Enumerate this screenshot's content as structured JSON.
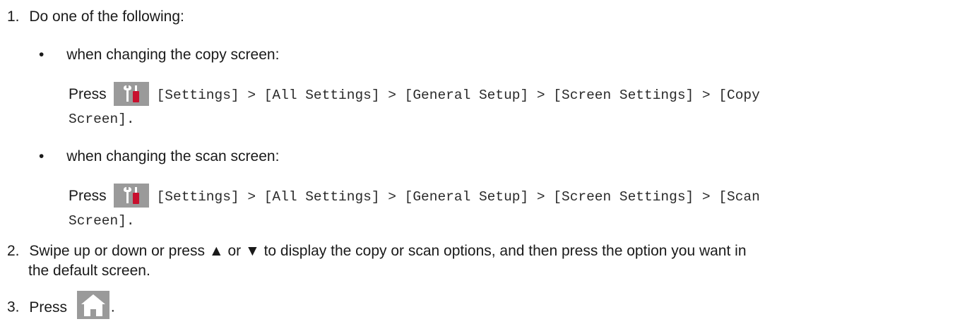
{
  "step1": {
    "number": "1.",
    "text": "Do one of the following:",
    "options": [
      {
        "bullet": "•",
        "text": "when changing the copy screen:",
        "press": "Press",
        "path": "[Settings] > [All Settings] > [General Setup] > [Screen Settings] > [Copy",
        "path_cont": "Screen]."
      },
      {
        "bullet": "•",
        "text": "when changing the scan screen:",
        "press": "Press",
        "path": "[Settings] > [All Settings] > [General Setup] > [Screen Settings] > [Scan",
        "path_cont": "Screen]."
      }
    ]
  },
  "step2": {
    "number": "2.",
    "line1": "Swipe up or down or press ▲ or ▼ to display the copy or scan options, and then press the option you want in",
    "line2": "the default screen."
  },
  "step3": {
    "number": "3.",
    "press": "Press",
    "suffix": "."
  },
  "icons": {
    "settings": "settings-icon",
    "home": "home-icon"
  },
  "colors": {
    "icon_bg": "#9a9a9a",
    "tool_red": "#c8102e"
  }
}
